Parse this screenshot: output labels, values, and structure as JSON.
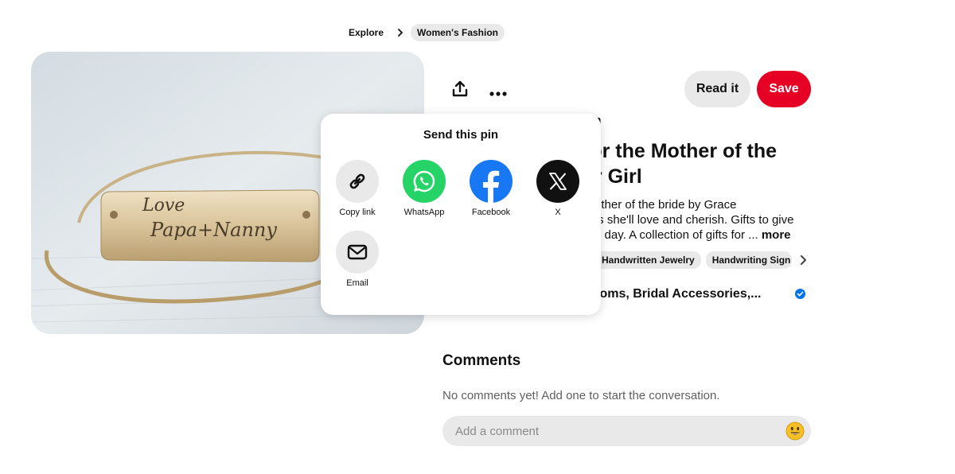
{
  "breadcrumb": {
    "explore_label": "Explore",
    "current_label": "Women's Fashion"
  },
  "pin": {
    "engraving_line1": "Love",
    "engraving_line2": "Papa+Nanny",
    "read_label": "Read it",
    "save_label": "Save",
    "source_text": "om",
    "title": "for the Mother of the er Girl",
    "title_line1": "for the Mother of the",
    "title_line2": "er Girl",
    "description_line1": "other of the bride by Grace",
    "description_line2": "ts she'll love and cherish. Gifts to give",
    "description_line3": "g day. A collection of gifts for ...",
    "more_label": "more",
    "tags": [
      "Handwritten Jewelry",
      "Handwriting Sign"
    ],
    "board_text": "rlooms, Bridal Accessories,..."
  },
  "comments": {
    "heading": "Comments",
    "empty_text": "No comments yet! Add one to start the conversation.",
    "placeholder": "Add a comment"
  },
  "share": {
    "title": "Send this pin",
    "options": [
      {
        "label": "Copy link",
        "icon": "link-icon",
        "color": "#e9e9e9"
      },
      {
        "label": "WhatsApp",
        "icon": "whatsapp-icon",
        "color": "#25d366"
      },
      {
        "label": "Facebook",
        "icon": "facebook-icon",
        "color": "#1877f2"
      },
      {
        "label": "X",
        "icon": "x-icon",
        "color": "#111111"
      },
      {
        "label": "Email",
        "icon": "email-icon",
        "color": "#e9e9e9"
      }
    ]
  },
  "colors": {
    "save_red": "#e60023",
    "chip_gray": "#e9e9e9",
    "verified_blue": "#0074e8"
  }
}
